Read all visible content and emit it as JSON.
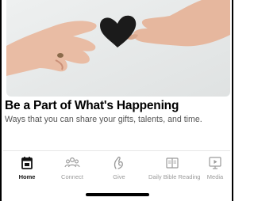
{
  "hero": {
    "title": "Be a Part of What's Happening",
    "subtitle": "Ways that you can share your gifts, talents, and time."
  },
  "tabbar": {
    "active_tab": "Home",
    "tabs": [
      {
        "label": "Home",
        "icon": "calendar-icon"
      },
      {
        "label": "Connect",
        "icon": "people-group-icon"
      },
      {
        "label": "Give",
        "icon": "give-hand-icon"
      },
      {
        "label": "Daily Bible Reading",
        "icon": "open-book-icon"
      },
      {
        "label": "Media",
        "icon": "play-video-icon"
      }
    ]
  },
  "colors": {
    "active": "#111111",
    "inactive": "#9a9a9a"
  }
}
